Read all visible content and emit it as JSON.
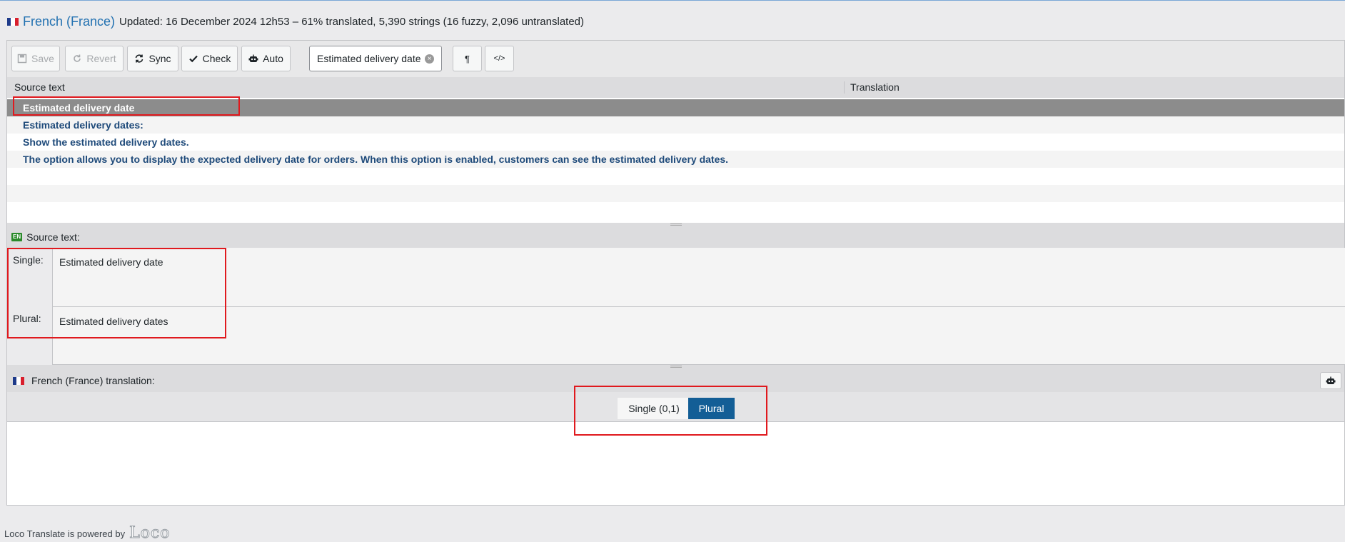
{
  "header": {
    "language": "French (France)",
    "meta": "Updated: 16 December 2024 12h53 – 61% translated, 5,390 strings (16 fuzzy, 2,096 untranslated)"
  },
  "toolbar": {
    "save_label": "Save",
    "revert_label": "Revert",
    "sync_label": "Sync",
    "check_label": "Check",
    "auto_label": "Auto",
    "search_value": "Estimated delivery date",
    "pilcrow_label": "¶",
    "code_label": "</>"
  },
  "list": {
    "col_source": "Source text",
    "col_translation": "Translation",
    "rows": [
      {
        "source": "Estimated delivery date"
      },
      {
        "source": "Estimated delivery dates:"
      },
      {
        "source": "Show the estimated delivery dates."
      },
      {
        "source": "The option allows you to display the expected delivery date for orders. When this option is enabled, customers can see the estimated delivery dates."
      }
    ],
    "selected_index": 0
  },
  "source": {
    "badge": "EN",
    "heading": "Source text:",
    "single_label": "Single:",
    "single_value": "Estimated delivery date",
    "plural_label": "Plural:",
    "plural_value": "Estimated delivery dates"
  },
  "translation": {
    "heading": "French (France) translation:",
    "tabs": [
      {
        "label": "Single (0,1)",
        "active": false
      },
      {
        "label": "Plural",
        "active": true
      }
    ],
    "value": ""
  },
  "footer": {
    "text": "Loco Translate is powered by",
    "logo": "Loco"
  },
  "colors": {
    "accent": "#2271b1",
    "active_tab": "#135e96",
    "selected_row": "#8c8c8c",
    "highlight": "#e0191e"
  }
}
